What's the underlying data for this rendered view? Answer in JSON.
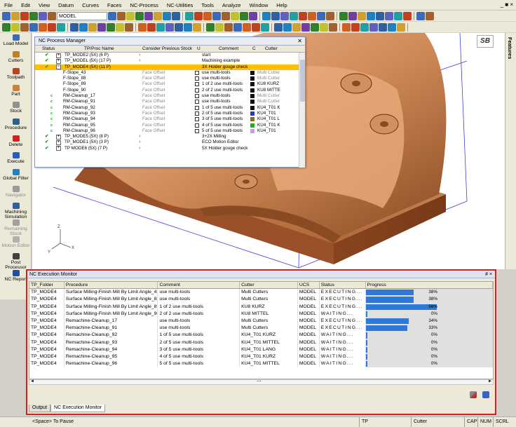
{
  "menu": [
    "File",
    "Edit",
    "View",
    "Datum",
    "Curves",
    "Faces",
    "NC-Process",
    "NC-Utilities",
    "Tools",
    "Analyze",
    "Window",
    "Help"
  ],
  "window_controls": "_ ■ ×",
  "toolbar": {
    "model_select": "MODEL"
  },
  "left_toolbar": [
    {
      "label": "Load Model",
      "color": "#3a6ab8",
      "enabled": true
    },
    {
      "label": "Cutters",
      "color": "#c08020",
      "enabled": true
    },
    {
      "label": "Toolpath",
      "color": "#c04020",
      "enabled": true
    },
    {
      "label": "Part",
      "color": "#d08030",
      "enabled": true
    },
    {
      "label": "Stock",
      "color": "#909090",
      "enabled": true
    },
    {
      "label": "Procedure",
      "color": "#306090",
      "enabled": true
    },
    {
      "label": "Delete",
      "color": "#d02020",
      "enabled": true
    },
    {
      "label": "Execute",
      "color": "#2060c0",
      "enabled": true
    },
    {
      "label": "Global Filter",
      "color": "#2080c0",
      "enabled": true
    },
    {
      "label": "Navigator",
      "color": "#9a9a9a",
      "enabled": false
    },
    {
      "label": "Machining Simulation",
      "color": "#3060a0",
      "enabled": true
    },
    {
      "label": "Remaining Stock",
      "color": "#a0a0a0",
      "enabled": false
    },
    {
      "label": "Motion Editor",
      "color": "#b0b0b0",
      "enabled": false
    },
    {
      "label": "Post Processor",
      "color": "#404040",
      "enabled": true
    },
    {
      "label": "NC Report",
      "color": "#2050a0",
      "enabled": true
    }
  ],
  "right_panel": {
    "label": "Features",
    "logo": "SB"
  },
  "process_manager": {
    "title": "NC Process Manager",
    "columns": [
      "Status",
      "TP/Proc Name",
      "Consider Previous Stock",
      "U",
      "Comment",
      "C",
      "Cutter"
    ],
    "rows": [
      {
        "status": "check",
        "expand": "+",
        "name": "TP_MODE2 (5X) (6 P)",
        "stock": "bulb",
        "stock_text": "",
        "u": false,
        "comment": "start",
        "swatch": "",
        "cutter": "",
        "selected": false,
        "indent": 0
      },
      {
        "status": "check",
        "expand": "+",
        "name": "TP_MODEL (5X) (17 P)",
        "stock": "bulb",
        "stock_text": "",
        "u": false,
        "comment": "Machining example",
        "swatch": "",
        "cutter": "",
        "selected": false,
        "indent": 0
      },
      {
        "status": "check",
        "expand": "-",
        "name": "TP_MODE4 (5X) (11 P)",
        "stock": "",
        "stock_text": "",
        "u": false,
        "comment": "3X Holder gouge check",
        "swatch": "",
        "cutter": "",
        "selected": true,
        "indent": 0
      },
      {
        "status": "",
        "expand": "",
        "name": "F-Slope_43",
        "stock": "",
        "stock_text": "Face Offset",
        "u": true,
        "comment": "use multi-tools",
        "swatch": "#111111",
        "cutter": "Multi Cutter",
        "selected": false,
        "indent": 1
      },
      {
        "status": "",
        "expand": "",
        "name": "F-Slope_88",
        "stock": "",
        "stock_text": "Face Offset",
        "u": true,
        "comment": "use multi-tools",
        "swatch": "#111111",
        "cutter": "Multi Cutter",
        "selected": false,
        "indent": 1
      },
      {
        "status": "",
        "expand": "",
        "name": "F-Slope_89",
        "stock": "",
        "stock_text": "Face Offset",
        "u": true,
        "comment": "1 of 2 use multi-tools",
        "swatch": "#111111",
        "cutter": "KU8 KURZ",
        "selected": false,
        "indent": 1
      },
      {
        "status": "",
        "expand": "",
        "name": "F-Slope_90",
        "stock": "",
        "stock_text": "Face Offset",
        "u": true,
        "comment": "2 of 2 use multi-tools",
        "swatch": "#111111",
        "cutter": "KU8 MITTE",
        "selected": false,
        "indent": 1
      },
      {
        "status": "c",
        "expand": "",
        "name": "RM-Cleanup_17",
        "stock": "",
        "stock_text": "Face Offset",
        "u": true,
        "comment": "use multi-tools",
        "swatch": "#111111",
        "cutter": "Multi Cutter",
        "selected": false,
        "indent": 1
      },
      {
        "status": "c",
        "expand": "",
        "name": "RM-Cleanup_91",
        "stock": "",
        "stock_text": "Face Offset",
        "u": true,
        "comment": "use multi-tools",
        "swatch": "#111111",
        "cutter": "Multi Cutter",
        "selected": false,
        "indent": 1
      },
      {
        "status": "c",
        "expand": "",
        "name": "RM-Cleanup_92",
        "stock": "",
        "stock_text": "Face Offset",
        "u": true,
        "comment": "1 of 5 use multi-tools",
        "swatch": "#111111",
        "cutter": "KU4_T01 K",
        "selected": false,
        "indent": 1
      },
      {
        "status": "c",
        "expand": "",
        "name": "RM-Cleanup_93",
        "stock": "",
        "stock_text": "Face Offset",
        "u": true,
        "comment": "2 of 5 use multi-tools",
        "swatch": "#2838c8",
        "cutter": "KU4_T01",
        "selected": false,
        "indent": 1
      },
      {
        "status": "c",
        "expand": "",
        "name": "RM-Cleanup_94",
        "stock": "",
        "stock_text": "Face Offset",
        "u": true,
        "comment": "3 of 5 use multi-tools",
        "swatch": "#8a6a2a",
        "cutter": "KU4_T01 L",
        "selected": false,
        "indent": 1
      },
      {
        "status": "c",
        "expand": "",
        "name": "RM-Cleanup_95",
        "stock": "",
        "stock_text": "Face Offset",
        "u": true,
        "comment": "4 of 5 use multi-tools",
        "swatch": "#28a828",
        "cutter": "KU4_T01 K",
        "selected": false,
        "indent": 1
      },
      {
        "status": "c",
        "expand": "",
        "name": "RM-Cleanup_96",
        "stock": "",
        "stock_text": "Face Offset",
        "u": true,
        "comment": "5 of 5 use multi-tools",
        "swatch": "#c8a0d8",
        "cutter": "KU4_T01",
        "selected": false,
        "indent": 1
      },
      {
        "status": "check",
        "expand": "+",
        "name": "TP_MODE5 (5X) (8 P)",
        "stock": "bulb",
        "stock_text": "",
        "u": false,
        "comment": "3+2X Milling",
        "swatch": "",
        "cutter": "",
        "selected": false,
        "indent": 0
      },
      {
        "status": "check",
        "expand": "+",
        "name": "TP_MODE1 (5X) (3 P)",
        "stock": "bulb",
        "stock_text": "",
        "u": false,
        "comment": "ECO Motion Editor",
        "swatch": "",
        "cutter": "",
        "selected": false,
        "indent": 0
      },
      {
        "status": "check",
        "expand": "+",
        "name": "TP MODE6 (5X) (7 P)",
        "stock": "bulb",
        "stock_text": "",
        "u": false,
        "comment": "5X Holder gouge check",
        "swatch": "",
        "cutter": "",
        "selected": false,
        "indent": 0
      }
    ]
  },
  "execution_monitor": {
    "title": "NC Execution Monitor",
    "pin": "# ×",
    "columns": [
      "TP_Folder",
      "Procedure",
      "Comment",
      "Cutter",
      "UCS",
      "Status",
      "Progress"
    ],
    "rows": [
      {
        "folder": "TP_MODE4",
        "procedure": "Surface Milling-Finish Mill By Limit Angle_43",
        "comment": "use multi-tools",
        "cutter": "Multi Cutters",
        "ucs": "MODEL",
        "status": "EXECUTING...",
        "progress": 38,
        "label": "38%"
      },
      {
        "folder": "TP_MODE4",
        "procedure": "Surface Milling-Finish Mill By Limit Angle_88",
        "comment": "use multi-tools",
        "cutter": "Multi Cutters",
        "ucs": "MODEL",
        "status": "EXECUTING...",
        "progress": 38,
        "label": "38%"
      },
      {
        "folder": "TP_MODE4",
        "procedure": "Surface Milling-Finish Mill By Limit Angle_89",
        "comment": "1 of 2 use multi-tools",
        "cutter": "KU8 KURZ",
        "ucs": "MODEL",
        "status": "EXECUTING...",
        "progress": 56,
        "label": "56%"
      },
      {
        "folder": "TP_MODE4",
        "procedure": "Surface Milling-Finish Mill By Limit Angle_90",
        "comment": "2 of 2 use multi-tools",
        "cutter": "KU8 MITTEL",
        "ucs": "MODEL",
        "status": "WAITING...",
        "progress": 0,
        "label": "0%"
      },
      {
        "folder": "TP_MODE4",
        "procedure": "Remachine-Cleanup_17",
        "comment": "use multi-tools",
        "cutter": "Multi Cutters",
        "ucs": "MODEL",
        "status": "EXECUTING...",
        "progress": 34,
        "label": "34%"
      },
      {
        "folder": "TP_MODE4",
        "procedure": "Remachine-Cleanup_91",
        "comment": "use multi-tools",
        "cutter": "Multi Cutters",
        "ucs": "MODEL",
        "status": "EXECUTING...",
        "progress": 33,
        "label": "33%"
      },
      {
        "folder": "TP_MODE4",
        "procedure": "Remachine-Cleanup_92",
        "comment": "1 of 5 use multi-tools",
        "cutter": "KU4_T01 KURZ",
        "ucs": "MODEL",
        "status": "WAITING...",
        "progress": 0,
        "label": "0%"
      },
      {
        "folder": "TP_MODE4",
        "procedure": "Remachine-Cleanup_93",
        "comment": "2 of 5 use multi-tools",
        "cutter": "KU4_T01 MITTEL",
        "ucs": "MODEL",
        "status": "WAITING...",
        "progress": 0,
        "label": "0%"
      },
      {
        "folder": "TP_MODE4",
        "procedure": "Remachine-Cleanup_94",
        "comment": "3 of 5 use multi-tools",
        "cutter": "KU4_T01 LANG",
        "ucs": "MODEL",
        "status": "WAITING...",
        "progress": 0,
        "label": "0%"
      },
      {
        "folder": "TP_MODE4",
        "procedure": "Remachine-Cleanup_95",
        "comment": "4 of 5 use multi-tools",
        "cutter": "KU4_T01 KURZ",
        "ucs": "MODEL",
        "status": "WAITING...",
        "progress": 0,
        "label": "0%"
      },
      {
        "folder": "TP_MODE4",
        "procedure": "Remachine-Cleanup_96",
        "comment": "5 of 5 use multi-tools",
        "cutter": "KU4_T01 MITTEL",
        "ucs": "MODEL",
        "status": "WAITING...",
        "progress": 0,
        "label": "0%"
      }
    ],
    "tabs": [
      "Output",
      "NC Execution Monitor"
    ],
    "active_tab": 1
  },
  "statusbar": {
    "hint": "<Space> To Pause",
    "tp": "TP",
    "cutter": "Cutter",
    "caps": "CAP",
    "num": "NUM",
    "scrl": "SCRL"
  },
  "colors": {
    "accent_red": "#d42020",
    "progress_blue": "#2e78d8",
    "selection": "#ffc000",
    "part_copper": "#c8804a"
  }
}
